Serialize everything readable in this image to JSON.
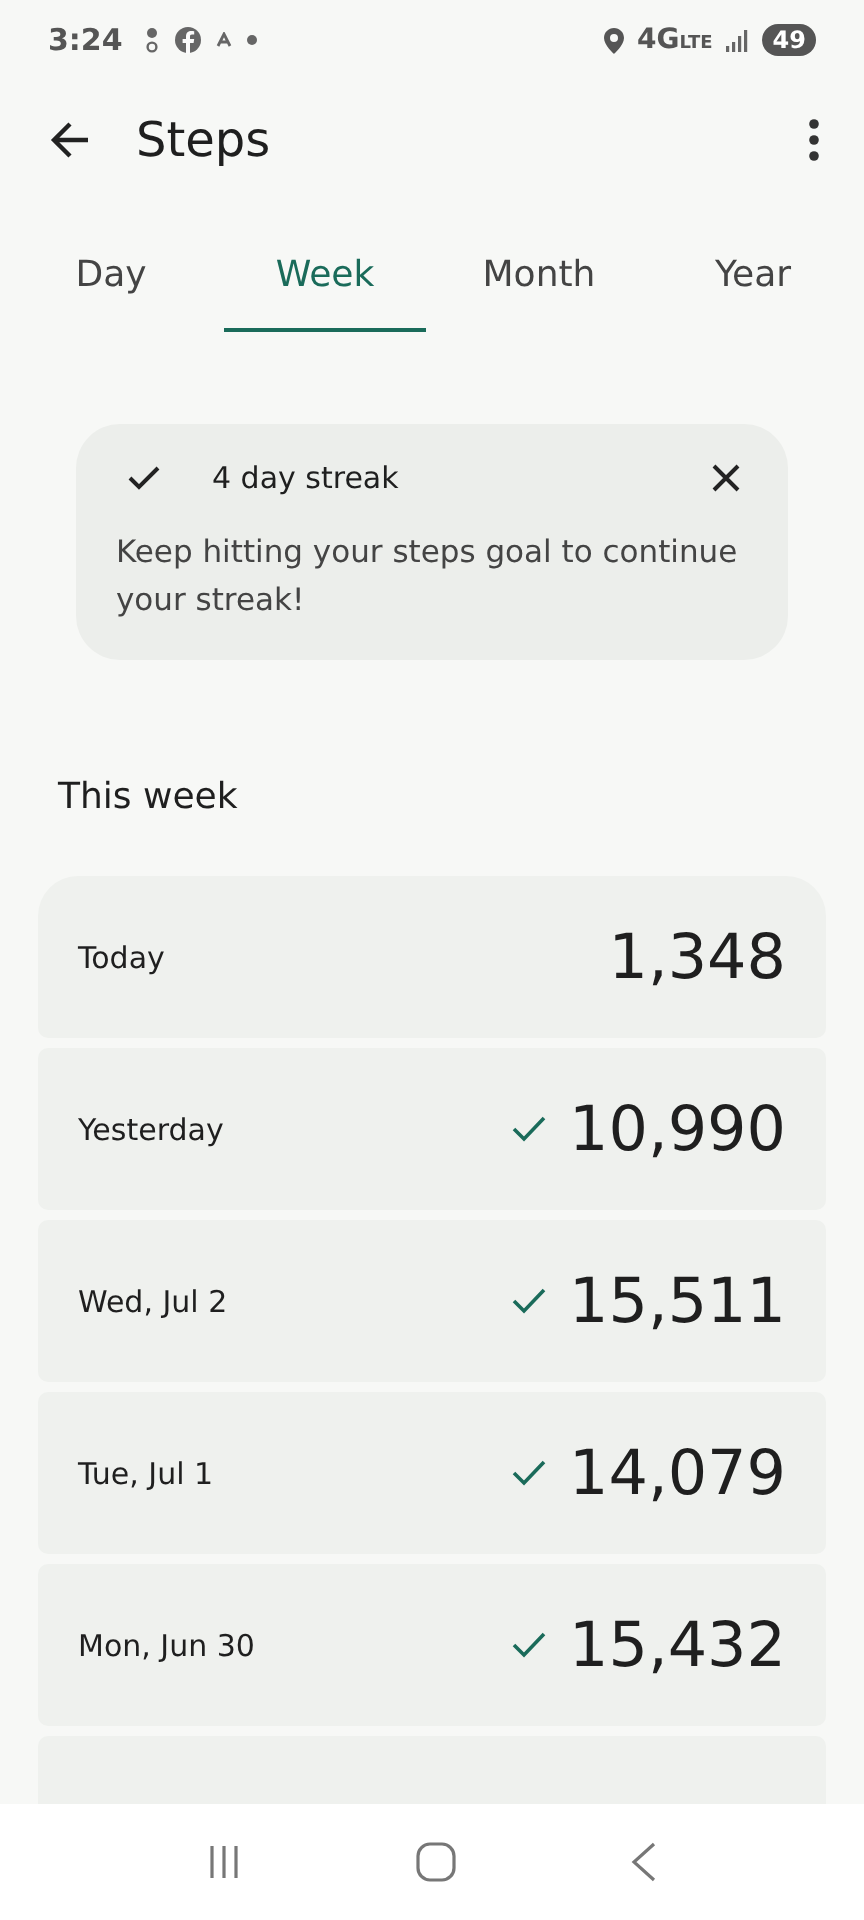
{
  "status_bar": {
    "time": "3:24",
    "network": "4G",
    "network_sub": "LTE",
    "battery": "49"
  },
  "header": {
    "title": "Steps"
  },
  "tabs": [
    {
      "label": "Day",
      "selected": false
    },
    {
      "label": "Week",
      "selected": true
    },
    {
      "label": "Month",
      "selected": false
    },
    {
      "label": "Year",
      "selected": false
    }
  ],
  "streak": {
    "title": "4 day streak",
    "message": "Keep hitting your steps goal to continue your streak!"
  },
  "section_title": "This week",
  "days": [
    {
      "label": "Today",
      "steps": "1,348",
      "goal_met": false
    },
    {
      "label": "Yesterday",
      "steps": "10,990",
      "goal_met": true
    },
    {
      "label": "Wed, Jul 2",
      "steps": "15,511",
      "goal_met": true
    },
    {
      "label": "Tue, Jul 1",
      "steps": "14,079",
      "goal_met": true
    },
    {
      "label": "Mon, Jun 30",
      "steps": "15,432",
      "goal_met": true
    }
  ]
}
